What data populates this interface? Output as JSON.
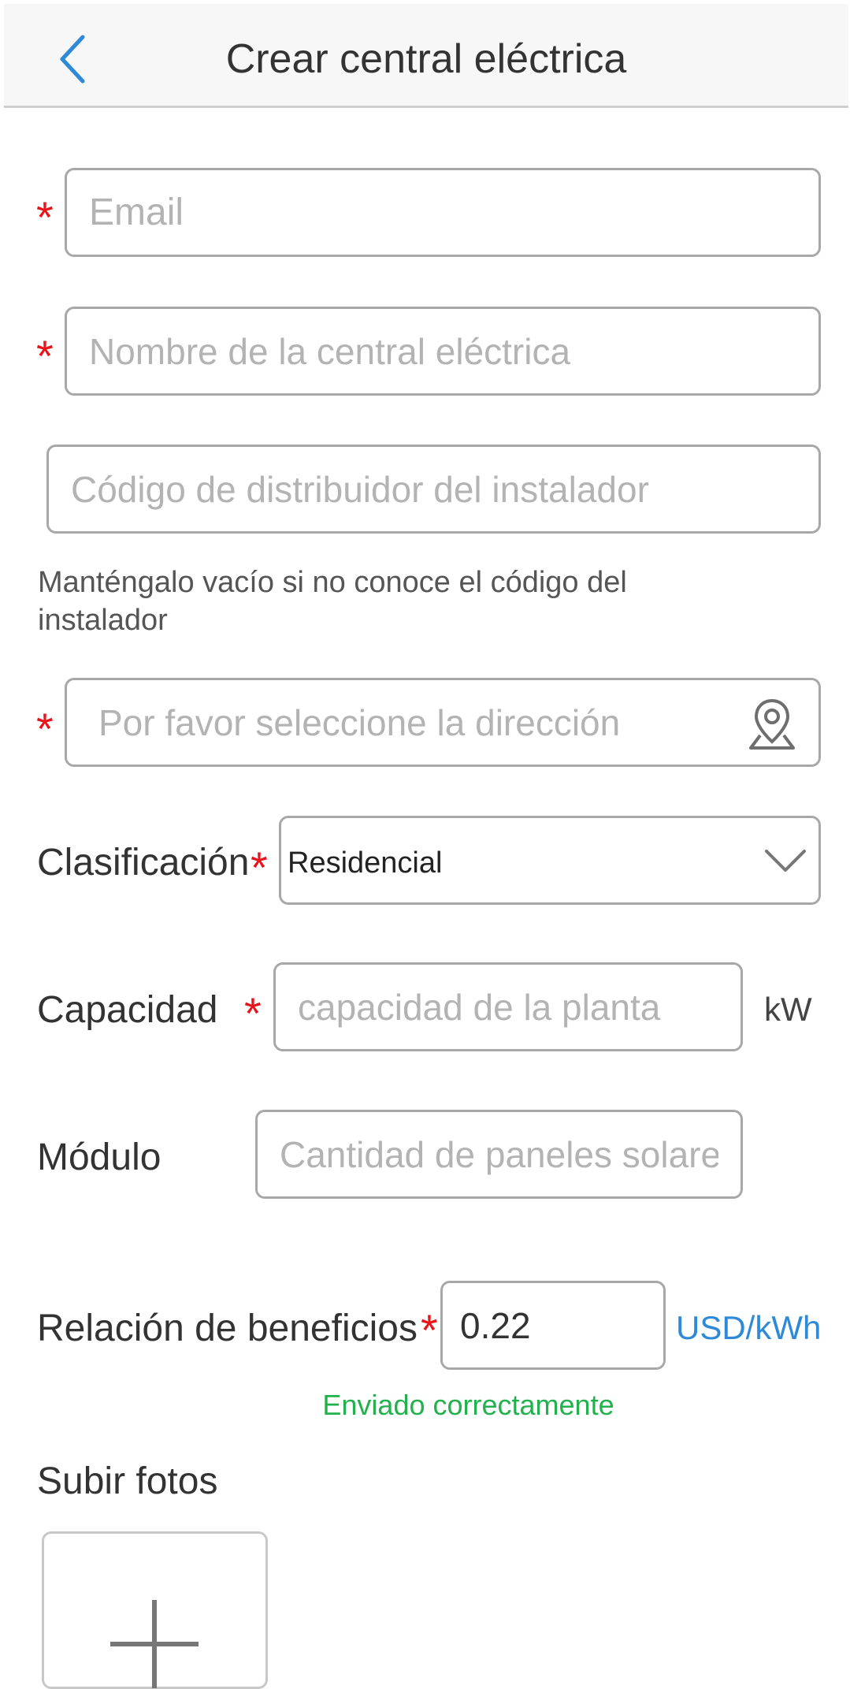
{
  "header": {
    "title": "Crear central eléctrica"
  },
  "form": {
    "email": {
      "placeholder": "Email",
      "value": ""
    },
    "plant_name": {
      "placeholder": "Nombre de la central eléctrica",
      "value": ""
    },
    "installer_code": {
      "placeholder": "Código de distribuidor del instalador",
      "value": "",
      "hint": "Manténgalo vacío si no conoce el código del instalador"
    },
    "address": {
      "placeholder": "Por favor seleccione la dirección",
      "value": ""
    },
    "classification": {
      "label": "Clasificación",
      "value": "Residencial"
    },
    "capacity": {
      "label": "Capacidad",
      "placeholder": "capacidad de la planta",
      "unit": "kW"
    },
    "module": {
      "label": "Módulo",
      "placeholder": "Cantidad de paneles solares"
    },
    "benefit": {
      "label": "Relación de beneficios",
      "value": "0.22",
      "unit": "USD/kWh"
    },
    "status": "Enviado correctamente",
    "upload_label": "Subir fotos"
  },
  "required_marker": "*",
  "colors": {
    "required": "#e8141b",
    "accent": "#2e8ad6",
    "success": "#22b14c"
  }
}
